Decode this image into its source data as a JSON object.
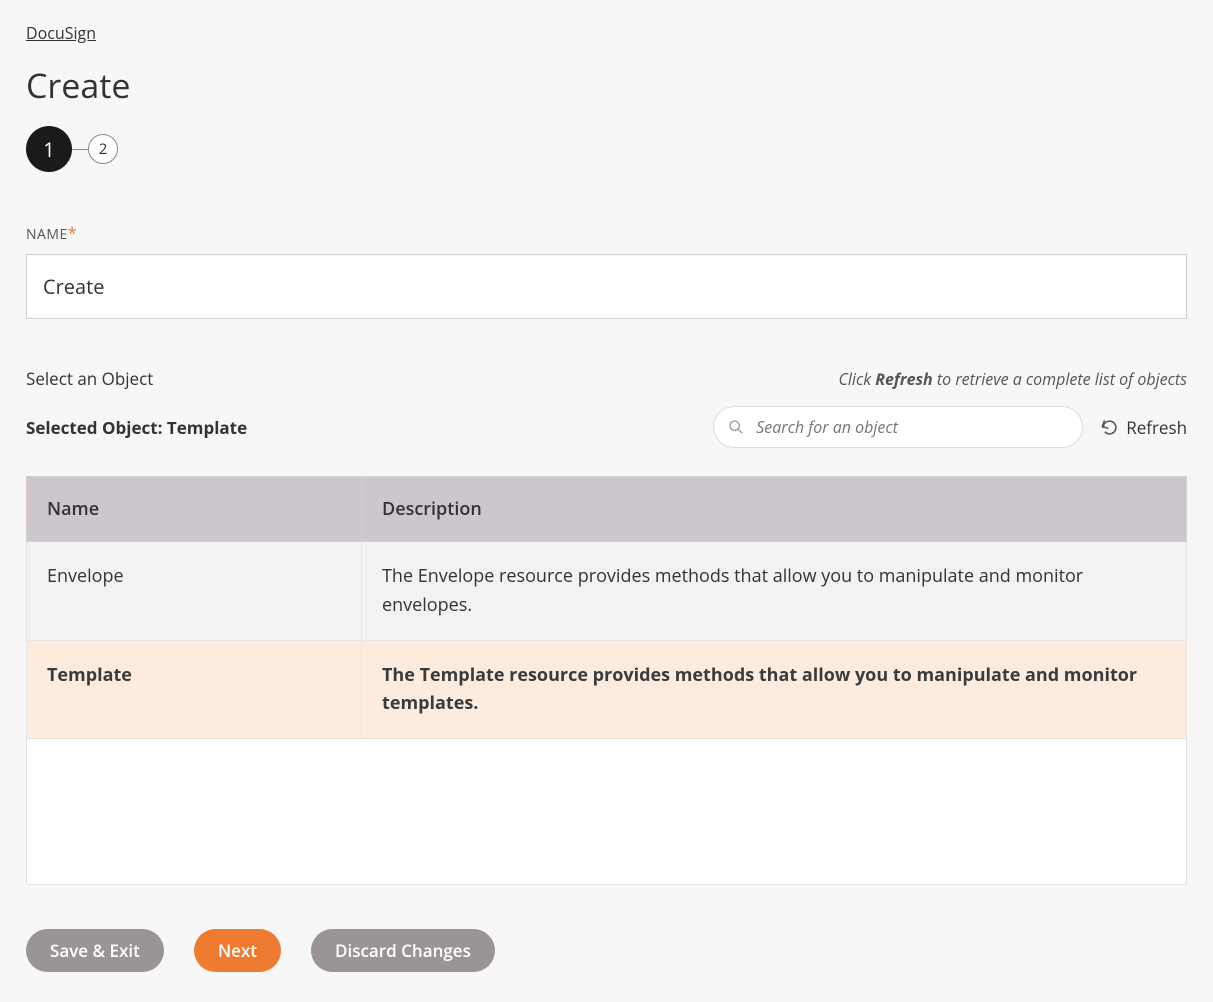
{
  "breadcrumb": {
    "label": "DocuSign"
  },
  "page": {
    "title": "Create"
  },
  "stepper": {
    "steps": [
      "1",
      "2"
    ],
    "activeIndex": 0
  },
  "nameField": {
    "label": "NAME",
    "value": "Create"
  },
  "objectSection": {
    "title": "Select an Object",
    "hint_prefix": "Click ",
    "hint_bold": "Refresh",
    "hint_suffix": " to retrieve a complete list of objects",
    "selected_prefix": "Selected Object: ",
    "selected_value": "Template",
    "search_placeholder": "Search for an object",
    "refresh_label": "Refresh"
  },
  "table": {
    "headers": {
      "name": "Name",
      "description": "Description"
    },
    "rows": [
      {
        "name": "Envelope",
        "description": "The Envelope resource provides methods that allow you to manipulate and monitor envelopes.",
        "selected": false
      },
      {
        "name": "Template",
        "description": "The Template resource provides methods that allow you to manipulate and monitor templates.",
        "selected": true
      }
    ]
  },
  "footer": {
    "save_exit": "Save & Exit",
    "next": "Next",
    "discard": "Discard Changes"
  }
}
